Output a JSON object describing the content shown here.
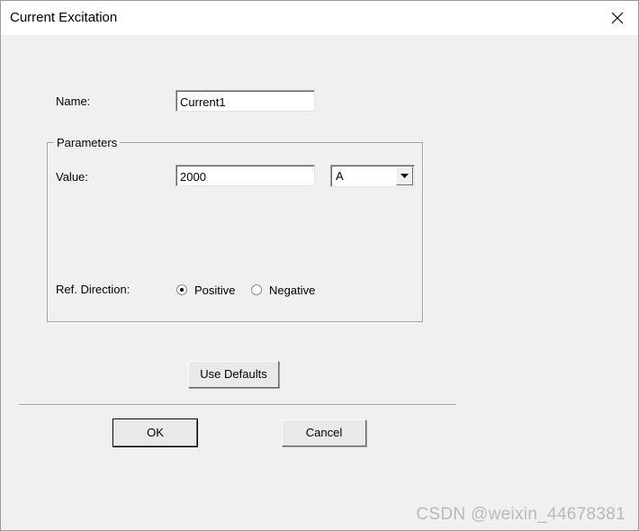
{
  "window": {
    "title": "Current Excitation",
    "close_icon": "close-icon"
  },
  "form": {
    "name_label": "Name:",
    "name_value": "Current1",
    "parameters_legend": "Parameters",
    "value_label": "Value:",
    "value_value": "2000",
    "unit_selected": "A",
    "ref_direction_label": "Ref. Direction:",
    "direction_options": {
      "positive": "Positive",
      "negative": "Negative"
    },
    "direction_selected": "Positive"
  },
  "buttons": {
    "use_defaults": "Use Defaults",
    "ok": "OK",
    "cancel": "Cancel"
  },
  "watermark": "CSDN @weixin_44678381"
}
